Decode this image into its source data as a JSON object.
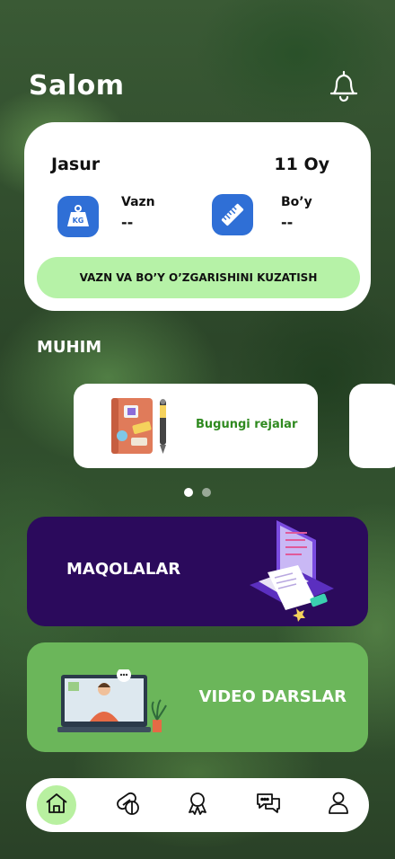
{
  "header": {
    "greeting": "Salom",
    "notification_icon": "bell-icon"
  },
  "profile": {
    "name": "Jasur",
    "age": "11 Oy",
    "weight": {
      "label": "Vazn",
      "value": "--",
      "icon": "weight-kg-icon",
      "icon_text": "KG"
    },
    "height": {
      "label": "Bo’y",
      "value": "--",
      "icon": "ruler-icon"
    },
    "track_button_label": "VAZN VA BO’Y O’ZGARISHINI KUZATISH",
    "accent_color": "#2f6fd6",
    "button_color": "#b6f2a7"
  },
  "important": {
    "title": "MUHIM",
    "cards": [
      {
        "label": "Bugungi rejalar",
        "icon": "planner-notebook-icon"
      }
    ],
    "pagination": {
      "total": 2,
      "active": 0
    }
  },
  "features": {
    "articles": {
      "label": "MAQOLALAR",
      "color": "#2b0a5c",
      "icon": "laptop-documents-icon"
    },
    "videos": {
      "label": "VIDEO DARSLAR",
      "color": "#6bb65a",
      "icon": "video-lesson-icon"
    }
  },
  "bottom_nav": {
    "items": [
      {
        "name": "home",
        "icon": "home-icon",
        "active": true
      },
      {
        "name": "medicine",
        "icon": "pills-icon",
        "active": false
      },
      {
        "name": "achievements",
        "icon": "award-icon",
        "active": false
      },
      {
        "name": "chat",
        "icon": "chat-icon",
        "active": false
      },
      {
        "name": "profile",
        "icon": "user-icon",
        "active": false
      }
    ],
    "active_color": "#b8f0a0"
  }
}
